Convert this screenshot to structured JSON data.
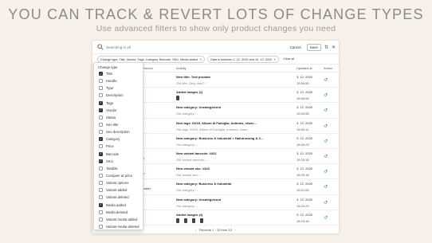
{
  "hero": {
    "title": "YOU CAN TRACK & REVERT LOTS OF CHANGE TYPES",
    "subtitle": "Use advanced filters to show only product changes you need"
  },
  "toolbar": {
    "search_placeholder": "Searching in all",
    "cancel_label": "Cancel",
    "save_label": "Save"
  },
  "filters": {
    "change_type": "Change type: Title, Vendor, Tags, Category, Barcode, SKU, Media added",
    "date": "Date is between 1. 12. 2020 and 10. 12. 2020",
    "clear_all": "Clear all"
  },
  "table": {
    "headers": {
      "product": "Product",
      "activity": "Activity",
      "updated": "Updated at",
      "action": "Action"
    },
    "rows": [
      {
        "product": "",
        "line1": "New title: Test produkt",
        "line2": "Old title: Zaky dobí?",
        "date": "3. 12. 2020",
        "time": "15:58:55"
      },
      {
        "product": "",
        "line1": "Added images (1)",
        "line2": "",
        "thumbs": 1,
        "date": "3. 12. 2020",
        "time": "15:58:55"
      },
      {
        "product": "",
        "line1": "New category: Uncategorized",
        "line2": "Old category: --",
        "date": "3. 12. 2020",
        "time": "15:53:58"
      },
      {
        "product": "",
        "line1": "New tags: 03/19, Album di Famiglia, bottoms, charc...",
        "line2": "Old tags: 03/19, Album di Famiglia, bottoms, charc...",
        "date": "3. 12. 2020",
        "time": "15:50:11"
      },
      {
        "product": "",
        "line1": "New category: Business & Industrial > Hairdressing & C...",
        "line2": "Old category: --",
        "date": "3. 12. 2020",
        "time": "15:26:23"
      },
      {
        "product": "er",
        "line1": "New variant barcode: #422",
        "line2": "Old variant barcode: --",
        "date": "3. 12. 2020",
        "time": "15:25:18"
      },
      {
        "product": "er",
        "line1": "New variant sku: #443",
        "line2": "Old variant sku: --",
        "date": "3. 12. 2020",
        "time": "15:25:18"
      },
      {
        "product": "ooster",
        "line1": "New category: Business & Industrial",
        "line2": "Old category: --",
        "date": "3. 12. 2020",
        "time": "15:21:06"
      },
      {
        "product": "",
        "line1": "New category: Uncategorized",
        "line2": "Old category: --",
        "date": "3. 12. 2020",
        "time": "15:20:29"
      },
      {
        "product": "",
        "line1": "Added images (4)",
        "line2": "",
        "thumbs": 4,
        "date": "3. 12. 2020",
        "time": "15:15:18"
      }
    ]
  },
  "pager": {
    "text": "Records 1 - 10 from 15",
    "prev": "‹",
    "next": "›"
  },
  "dropdown": {
    "title": "Change type",
    "items": [
      {
        "label": "Title",
        "checked": true
      },
      {
        "label": "Handle",
        "checked": false
      },
      {
        "label": "Type",
        "checked": false
      },
      {
        "label": "Description",
        "checked": false
      },
      {
        "label": "Tags",
        "checked": true
      },
      {
        "label": "Vendor",
        "checked": true
      },
      {
        "label": "Status",
        "checked": false
      },
      {
        "label": "Seo title",
        "checked": false
      },
      {
        "label": "Seo description",
        "checked": false
      },
      {
        "label": "Category",
        "checked": true
      },
      {
        "label": "Price",
        "checked": false
      },
      {
        "label": "Barcode",
        "checked": true
      },
      {
        "label": "SKU",
        "checked": true
      },
      {
        "label": "Taxable",
        "checked": false
      },
      {
        "label": "Compare at price",
        "checked": false
      },
      {
        "label": "Variant options",
        "checked": false
      },
      {
        "label": "Variant added",
        "checked": false
      },
      {
        "label": "Variant deleted",
        "checked": false
      },
      {
        "label": "Media added",
        "checked": true
      },
      {
        "label": "Media deleted",
        "checked": false
      },
      {
        "label": "Variant media added",
        "checked": false
      },
      {
        "label": "Variant media deleted",
        "checked": false
      }
    ]
  },
  "colors": {
    "background": "#f7f1ea",
    "revert_icon": "#2e8b57"
  }
}
